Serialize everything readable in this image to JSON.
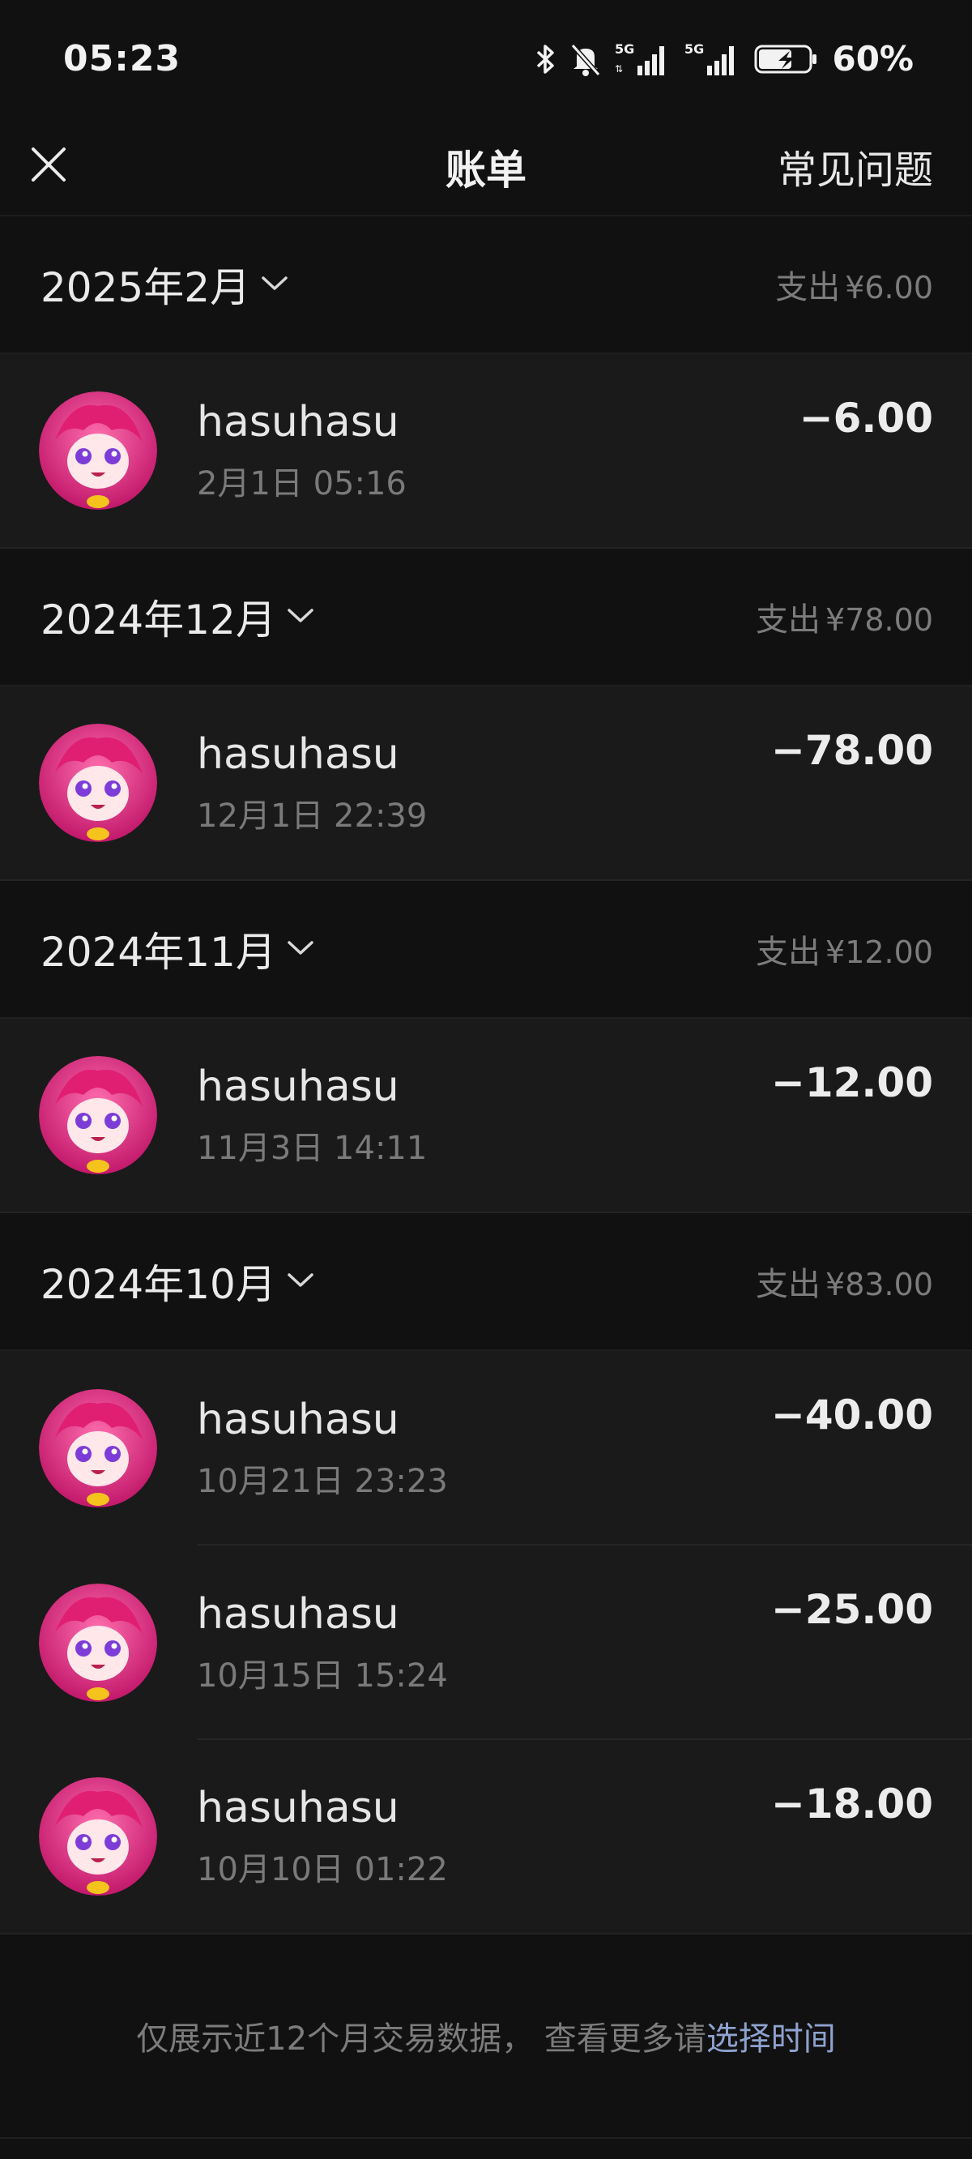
{
  "status_bar": {
    "time": "05:23",
    "battery": "60%",
    "icons": [
      "bluetooth-icon",
      "mute-bell-icon",
      "signal-5g-icon",
      "signal-5g-icon",
      "battery-icon"
    ]
  },
  "header": {
    "title": "账单",
    "faq": "常见问题",
    "close_icon": "close-icon"
  },
  "groups": [
    {
      "month": "2025年2月",
      "summary_label": "支出",
      "summary_amount": "¥6.00",
      "items": [
        {
          "name": "hasuhasu",
          "time": "2月1日 05:16",
          "amount": "−6.00"
        }
      ]
    },
    {
      "month": "2024年12月",
      "summary_label": "支出",
      "summary_amount": "¥78.00",
      "items": [
        {
          "name": "hasuhasu",
          "time": "12月1日 22:39",
          "amount": "−78.00"
        }
      ]
    },
    {
      "month": "2024年11月",
      "summary_label": "支出",
      "summary_amount": "¥12.00",
      "items": [
        {
          "name": "hasuhasu",
          "time": "11月3日 14:11",
          "amount": "−12.00"
        }
      ]
    },
    {
      "month": "2024年10月",
      "summary_label": "支出",
      "summary_amount": "¥83.00",
      "items": [
        {
          "name": "hasuhasu",
          "time": "10月21日 23:23",
          "amount": "−40.00"
        },
        {
          "name": "hasuhasu",
          "time": "10月15日 15:24",
          "amount": "−25.00"
        },
        {
          "name": "hasuhasu",
          "time": "10月10日 01:22",
          "amount": "−18.00"
        }
      ]
    }
  ],
  "footer": {
    "note": "仅展示近12个月交易数据， 查看更多请",
    "link": "选择时间"
  },
  "colors": {
    "background": "#111111",
    "row_background": "#1a1a1a",
    "link": "#8ea2cf",
    "muted_text": "#7a7a7a"
  }
}
